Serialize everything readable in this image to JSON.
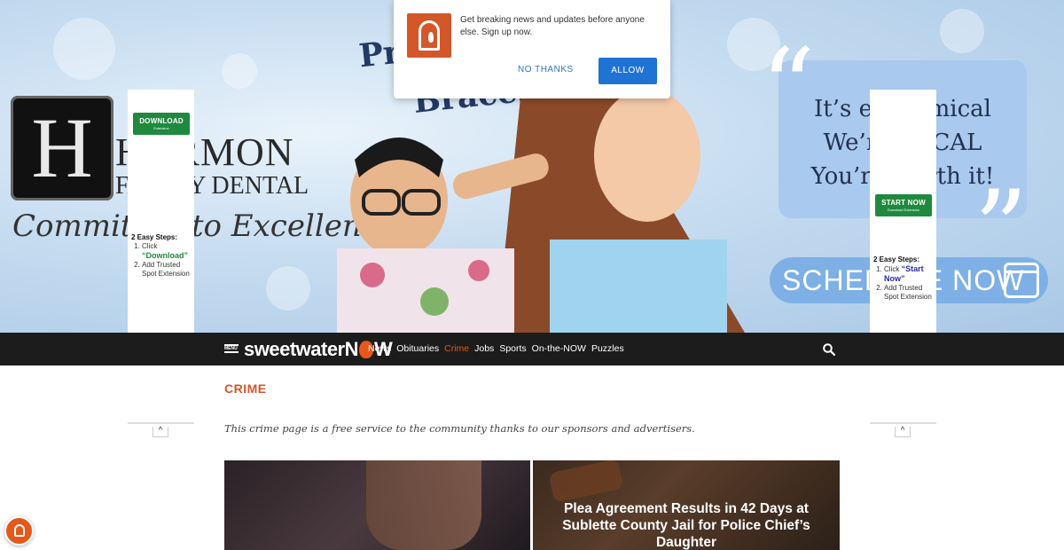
{
  "notification": {
    "message": "Get breaking news and updates before anyone else. Sign up now.",
    "no_thanks_label": "NO THANKS",
    "allow_label": "ALLOW",
    "accent_color": "#1e73d3"
  },
  "banner_ad": {
    "logo_letter": "H",
    "logo_name": "HARMON",
    "logo_sub": "FAMILY DENTAL",
    "tagline": "Committed to Excellence",
    "headline_line1": "Pr",
    "headline_line2": "Braces!",
    "quote_text": "It’s economical\nWe’re LOCAL\nYou’re worth it!",
    "schedule_label": "SCHEDULE NOW",
    "icon": "calendar-icon"
  },
  "side_ad_left": {
    "button_label": "DOWNLOAD",
    "button_sub": "Extension",
    "steps_title": "2 Easy Steps:",
    "step1_prefix": "Click",
    "step1_highlight": "“Download”",
    "step2": "Add Trusted Spot Extension"
  },
  "side_ad_right": {
    "button_label": "START NOW",
    "button_sub": "Download Extension",
    "steps_title": "2 Easy Steps:",
    "step1_prefix": "Click",
    "step1_highlight": "“Start Now”",
    "step2": "Add Trusted Spot Extension"
  },
  "nav": {
    "menu_label": "MENU",
    "brand_prefix": "sweetwater",
    "brand_suffix_left": "N",
    "brand_suffix_right": "W",
    "links": [
      "News",
      "Obituaries",
      "Crime",
      "Jobs",
      "Sports",
      "On-the-NOW",
      "Puzzles"
    ],
    "active_link": "Crime",
    "accent_color": "#e5571a"
  },
  "main": {
    "section_title": "CRIME",
    "intro": "This crime page is a free service to the community thanks to our sponsors and advertisers.",
    "cards": [
      {
        "title": ""
      },
      {
        "title": "Plea Agreement Results in 42 Days at Sublette County Jail for Police Chief’s Daughter"
      }
    ]
  }
}
